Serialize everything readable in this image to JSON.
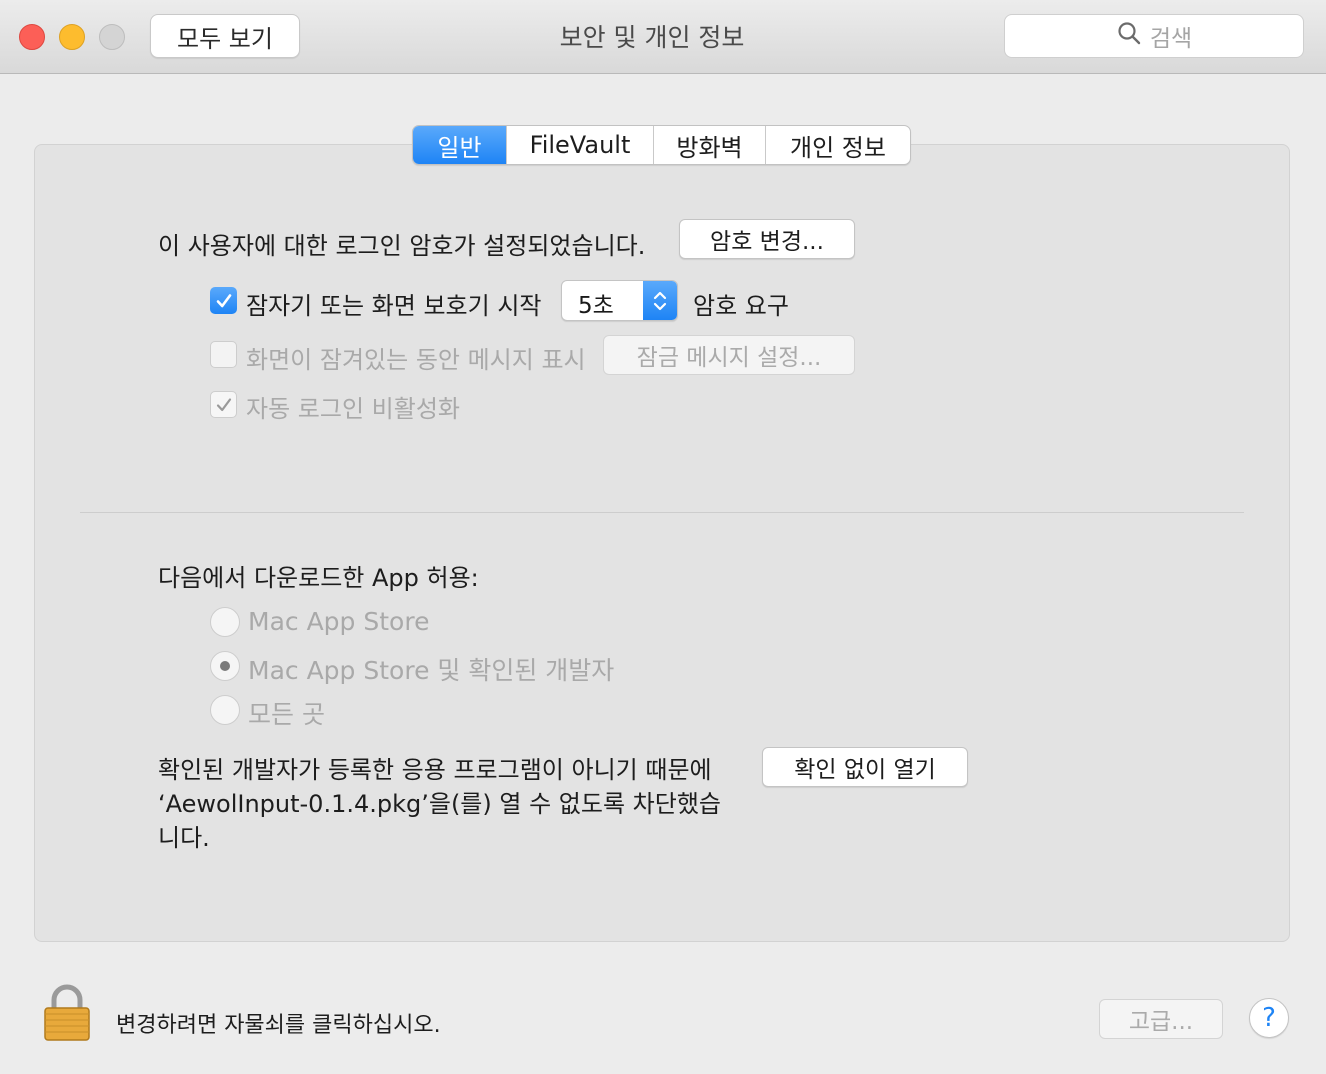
{
  "window": {
    "title": "보안 및 개인 정보",
    "show_all_label": "모두 보기",
    "search_placeholder": "검색"
  },
  "tabs": [
    {
      "label": "일반",
      "active": true
    },
    {
      "label": "FileVault",
      "active": false
    },
    {
      "label": "방화벽",
      "active": false
    },
    {
      "label": "개인 정보",
      "active": false
    }
  ],
  "general": {
    "login_password_text": "이 사용자에 대한 로그인 암호가 설정되었습니다.",
    "change_password_label": "암호 변경...",
    "require_password": {
      "checked": true,
      "label": "잠자기 또는 화면 보호기 시작",
      "delay_value": "5초",
      "suffix": "암호 요구"
    },
    "show_message": {
      "checked": false,
      "label": "화면이 잠겨있는 동안 메시지 표시",
      "button_label": "잠금 메시지 설정..."
    },
    "disable_auto_login": {
      "checked": true,
      "label": "자동 로그인 비활성화"
    }
  },
  "downloads": {
    "heading": "다음에서 다운로드한 App 허용:",
    "options": [
      {
        "label": "Mac App Store",
        "selected": false
      },
      {
        "label": "Mac App Store 및 확인된 개발자",
        "selected": true
      },
      {
        "label": "모든 곳",
        "selected": false
      }
    ],
    "blocked_message": "확인된 개발자가 등록한 응용 프로그램이 아니기 때문에 ‘AewolInput-0.1.4.pkg’을(를) 열 수 없도록 차단했습니다.",
    "open_anyway_label": "확인 없이 열기"
  },
  "footer": {
    "lock_text": "변경하려면 자물쇠를 클릭하십시오.",
    "advanced_label": "고급...",
    "help_label": "?"
  },
  "colors": {
    "accent": "#1e84f5",
    "close": "#fc5f57",
    "minimize": "#fdbc2e",
    "lock_gold": "#e8a93b"
  }
}
